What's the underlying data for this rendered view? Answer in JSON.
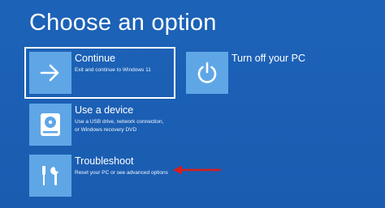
{
  "heading": "Choose an option",
  "options": [
    {
      "title": "Continue",
      "description": [
        "Exit and continue to Windows 11"
      ],
      "icon": "arrow-right-icon",
      "selected": true
    },
    {
      "title": "Turn off your PC",
      "description": [],
      "icon": "power-icon",
      "selected": false
    },
    {
      "title": "Use a device",
      "description": [
        "Use a USB drive, network connection,",
        "or Windows recovery DVD"
      ],
      "icon": "disc-drive-icon",
      "selected": false
    },
    {
      "title": "Troubleshoot",
      "description": [
        "Reset your PC or see advanced options"
      ],
      "icon": "tools-icon",
      "selected": false
    }
  ],
  "colors": {
    "background": "#1a5fb4",
    "tile": "#5fa6e6",
    "annotation_arrow": "#d81e1e"
  }
}
